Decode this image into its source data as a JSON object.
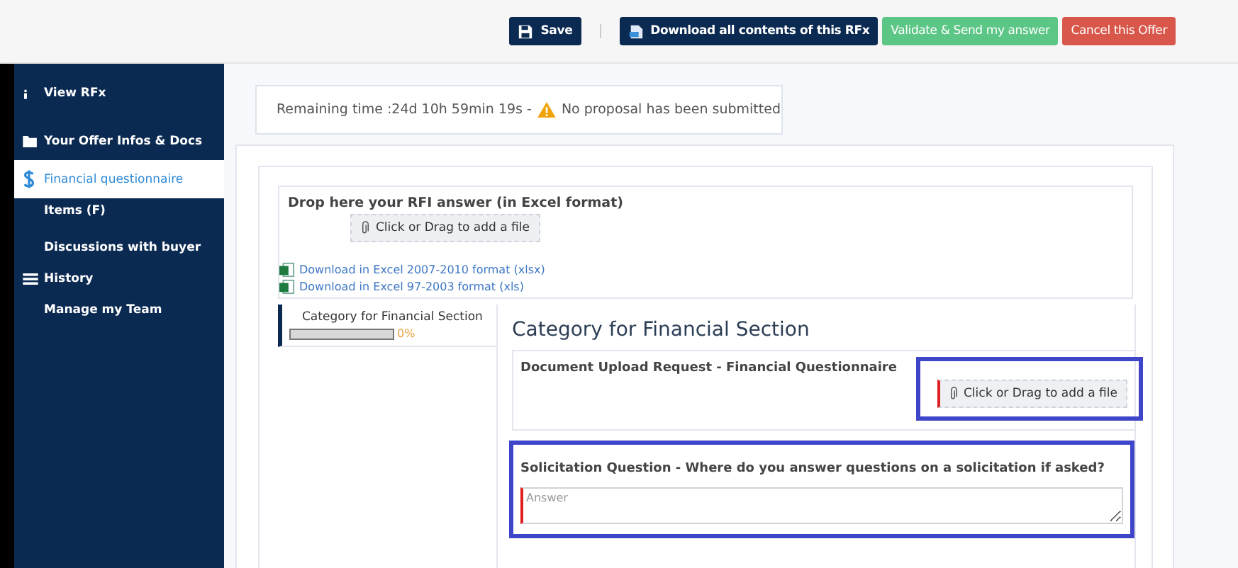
{
  "toolbar": {
    "buttons": [
      {
        "kind": "save",
        "label": "Save"
      },
      {
        "kind": "download",
        "label": "Download all contents of this RFx"
      },
      {
        "kind": "validate",
        "label": "Validate & Send my answer"
      },
      {
        "kind": "cancel",
        "label": "Cancel this Offer"
      }
    ]
  },
  "sidebar": {
    "items": [
      {
        "kind": "info",
        "label": "View RFx",
        "selected": false
      },
      {
        "kind": "folder",
        "label": "Your Offer Infos & Docs",
        "selected": false
      },
      {
        "kind": "dollar",
        "label": "Financial questionnaire",
        "selected": true
      },
      {
        "kind": "plain",
        "label": "Items (F)",
        "selected": false
      },
      {
        "kind": "plain",
        "label": "Discussions with buyer",
        "selected": false
      },
      {
        "kind": "list",
        "label": "History",
        "selected": false
      },
      {
        "kind": "plain",
        "label": "Manage my Team",
        "selected": false
      }
    ]
  },
  "status": {
    "remaining": "Remaining time :24d 10h 59min 19s -",
    "message": "No proposal has been submitted"
  },
  "excel_drop": {
    "title": "Drop here your RFI answer (in Excel format)",
    "button": "Click or Drag to add a file",
    "links": [
      "Download in Excel 2007-2010 format (xlsx)",
      "Download in Excel 97-2003 format (xls)"
    ]
  },
  "categories": [
    {
      "label": "Category for Financial Section",
      "level": 0,
      "percent": "0%",
      "selected": true
    }
  ],
  "section": {
    "title": "Category for Financial Section",
    "questions": [
      {
        "kind": "upload",
        "title": "Document Upload Request - Financial Questionnaire",
        "button": "Click or Drag to add a file",
        "highlighted": true
      },
      {
        "kind": "text",
        "title": "Solicitation Question - Where do you answer questions on a solicitation if asked?",
        "placeholder": "Answer",
        "highlighted": true
      }
    ]
  }
}
